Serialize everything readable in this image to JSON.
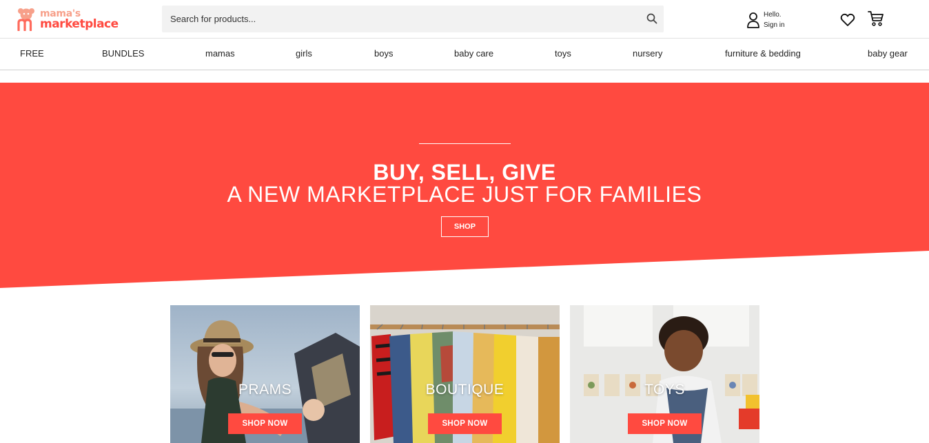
{
  "brand": {
    "line1": "mama's",
    "line2": "marketplace",
    "colors": {
      "primary": "#ff4a40",
      "secondary": "#f7a08a"
    }
  },
  "search": {
    "placeholder": "Search for products..."
  },
  "account": {
    "greeting": "Hello.",
    "signin": "Sign in"
  },
  "icons": {
    "search": "search-icon",
    "user": "user-icon",
    "wishlist": "heart-icon",
    "cart": "cart-icon"
  },
  "nav": {
    "items": [
      {
        "label": "FREE"
      },
      {
        "label": "BUNDLES"
      },
      {
        "label": "mamas"
      },
      {
        "label": "girls"
      },
      {
        "label": "boys"
      },
      {
        "label": "baby care"
      },
      {
        "label": "toys"
      },
      {
        "label": "nursery"
      },
      {
        "label": "furniture & bedding"
      },
      {
        "label": "baby gear"
      }
    ]
  },
  "hero": {
    "title": "BUY, SELL, GIVE",
    "subtitle": "A NEW MARKETPLACE JUST FOR FAMILIES",
    "button": "SHOP"
  },
  "categories": [
    {
      "label": "PRAMS",
      "button": "SHOP NOW"
    },
    {
      "label": "BOUTIQUE",
      "button": "SHOP NOW"
    },
    {
      "label": "TOYS",
      "button": "SHOP NOW"
    }
  ]
}
